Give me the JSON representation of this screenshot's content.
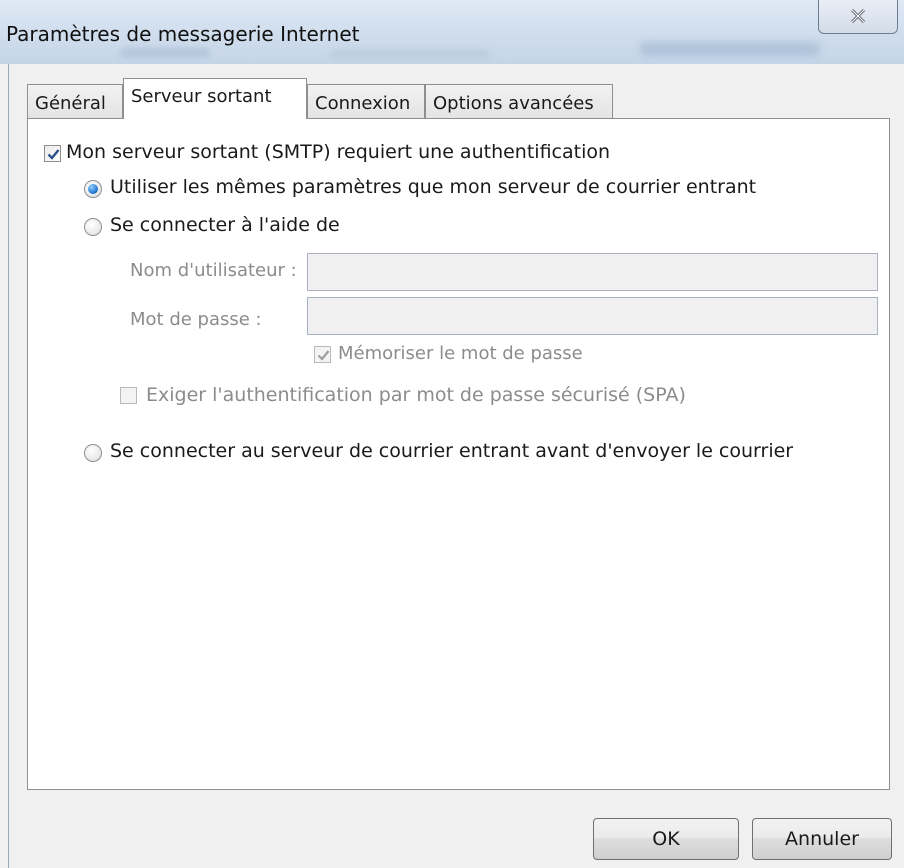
{
  "window": {
    "title": "Paramètres de messagerie Internet",
    "close_icon": "close-icon"
  },
  "tabs": [
    {
      "label": "Général",
      "active": false
    },
    {
      "label": "Serveur sortant",
      "active": true
    },
    {
      "label": "Connexion",
      "active": false
    },
    {
      "label": "Options avancées",
      "active": false
    }
  ],
  "smtp_auth": {
    "label": "Mon serveur sortant (SMTP) requiert une authentification",
    "checked": true
  },
  "radio_same": {
    "label": "Utiliser les mêmes paramètres que mon serveur de courrier entrant",
    "selected": true
  },
  "radio_connect": {
    "label": "Se connecter à l'aide de",
    "selected": false
  },
  "username": {
    "label": "Nom d'utilisateur :",
    "value": ""
  },
  "password": {
    "label": "Mot de passe :",
    "value": ""
  },
  "remember_password": {
    "label": "Mémoriser le mot de passe",
    "checked": true,
    "disabled": true
  },
  "require_spa": {
    "label": "Exiger l'authentification par mot de passe sécurisé (SPA)",
    "checked": false,
    "disabled": true
  },
  "radio_incoming": {
    "label": "Se connecter au serveur de courrier entrant avant d'envoyer le courrier",
    "selected": false
  },
  "buttons": {
    "ok": "OK",
    "cancel": "Annuler"
  }
}
